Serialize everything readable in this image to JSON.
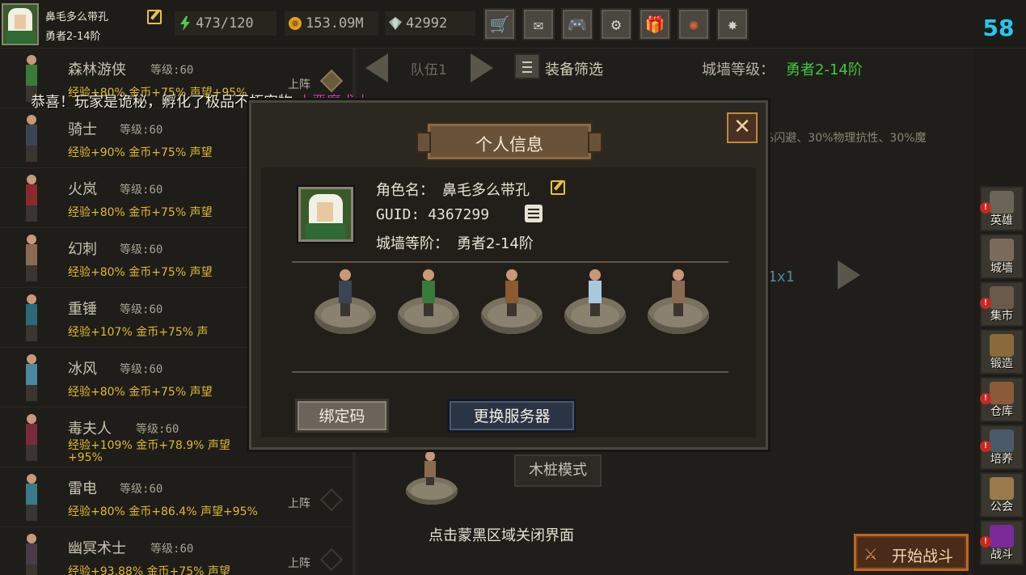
{
  "player": {
    "name": "鼻毛多么带孔",
    "rank": "勇者2-14阶"
  },
  "resources": {
    "energy": "473/120",
    "gold": "153.09M",
    "gems": "42992"
  },
  "top_buttons": [
    "cart-icon",
    "mail-icon",
    "gamepad-icon",
    "settings-icon",
    "gift-icon",
    "aperture-icon",
    "firework-icon"
  ],
  "fps": "58",
  "heroes": [
    {
      "name": "森林游侠",
      "level_label": "等级:",
      "level": "60",
      "stats": "经验+80% 金币+75% 声望+95%",
      "deploy": "上阵",
      "color": "#3a7a3a"
    },
    {
      "name": "骑士",
      "level_label": "等级:",
      "level": "60",
      "stats": "经验+90%   金币+75%   声望",
      "deploy": "",
      "color": "#3a4454"
    },
    {
      "name": "火岚",
      "level_label": "等级:",
      "level": "60",
      "stats": "经验+80%   金币+75%   声望",
      "deploy": "",
      "color": "#8a2a2a"
    },
    {
      "name": "幻刺",
      "level_label": "等级:",
      "level": "60",
      "stats": "经验+80%   金币+75%   声望",
      "deploy": "",
      "color": "#8a6a50"
    },
    {
      "name": "重锤",
      "level_label": "等级:",
      "level": "60",
      "stats": "经验+107%   金币+75%   声",
      "deploy": "",
      "color": "#2a6a7a"
    },
    {
      "name": "冰风",
      "level_label": "等级:",
      "level": "60",
      "stats": "经验+80%   金币+75%   声望",
      "deploy": "",
      "color": "#4a8aa0"
    },
    {
      "name": "毒夫人",
      "level_label": "等级:",
      "level": "60",
      "stats": "经验+109%   金币+78.9%   声望",
      "stats2": "+95%",
      "deploy": "",
      "color": "#7a2a3a"
    },
    {
      "name": "雷电",
      "level_label": "等级:",
      "level": "60",
      "stats": "经验+80%   金币+86.4%   声望+95%",
      "deploy": "上阵",
      "color": "#3a7a8a"
    },
    {
      "name": "幽冥术士",
      "level_label": "等级:",
      "level": "60",
      "stats": "经验+93.88%   金币+75%   声望",
      "deploy": "上阵",
      "color": "#4a3a4a"
    }
  ],
  "notice": {
    "text": "恭喜！玩家是诡秘，孵化了极品不朽宠物",
    "pet": "小恶魔术士"
  },
  "team": {
    "label": "队伍1",
    "filter_label": "装备筛选",
    "wall_label": "城墙等级：",
    "wall_value": "勇者2-14阶",
    "bonus_text": "%闪避、30%物理抗性、30%魔",
    "formation": "1x1",
    "dummy_mode": "木桩模式",
    "close_hint": "点击蒙黑区域关闭界面"
  },
  "sidebar": [
    {
      "label": "英雄",
      "alert": true,
      "color": "#6a6456"
    },
    {
      "label": "城墙",
      "alert": false,
      "color": "#7a6a5a"
    },
    {
      "label": "集市",
      "alert": true,
      "color": "#6a5a4a"
    },
    {
      "label": "锻造",
      "alert": false,
      "color": "#8a6a3a"
    },
    {
      "label": "仓库",
      "alert": true,
      "color": "#8a5a3a"
    },
    {
      "label": "培养",
      "alert": true,
      "color": "#4a5a6a"
    },
    {
      "label": "公会",
      "alert": false,
      "color": "#9a7a4a"
    },
    {
      "label": "战斗",
      "alert": true,
      "color": "#7a2a9a"
    }
  ],
  "start_battle": "开始战斗",
  "modal": {
    "title": "个人信息",
    "close": "✕",
    "role_label": "角色名：",
    "role_value": "鼻毛多么带孔",
    "guid_label": "GUID:",
    "guid_value": "4367299",
    "wall_label": "城墙等阶：",
    "wall_value": "勇者2-14阶",
    "bind_button": "绑定码",
    "server_button": "更换服务器",
    "team_colors": [
      "#3a4454",
      "#3a7a3a",
      "#8a5a30",
      "#a8c8e0",
      "#8a6a50"
    ]
  }
}
